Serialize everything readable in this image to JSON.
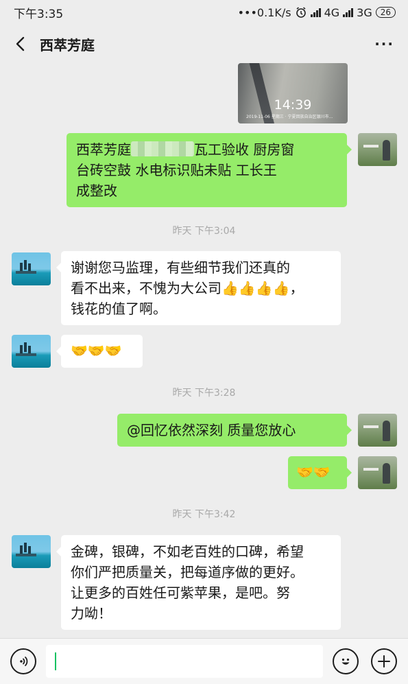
{
  "status_bar": {
    "time": "下午3:35",
    "speed": "•••0.1K/s",
    "alarm_icon": "alarm-clock-icon",
    "network_1": "4G",
    "network_2": "3G",
    "battery": "26"
  },
  "header": {
    "back_icon": "chevron-left-icon",
    "title": "西萃芳庭",
    "more_icon": "more-dots-icon",
    "more_label": "···"
  },
  "messages": {
    "photo": {
      "time": "14:39",
      "stamp": "2019-11-06 星期三 · 宁夏回族自治区银川市…"
    },
    "m1": {
      "before_blur": "西萃芳庭",
      "line1_after": "瓦工验收  厨房窗",
      "line2": "台砖空鼓  水电标识贴未贴  工长王",
      "line3": "成整改"
    },
    "t1": "昨天 下午3:04",
    "m2": {
      "line1": "谢谢您马监理，有些细节我们还真的",
      "line2_text": "看不出来，不愧为大公司",
      "line2_emoji": "👍👍👍👍",
      "line2_end": "，",
      "line3": "钱花的值了啊。"
    },
    "m3": {
      "emoji": "🤝🤝🤝"
    },
    "t2": "昨天 下午3:28",
    "m4": {
      "text": "@回忆依然深刻  质量您放心"
    },
    "m5": {
      "emoji": "🤝🤝"
    },
    "t3": "昨天 下午3:42",
    "m6": {
      "line1": "金碑，银碑，不如老百姓的口碑，希望",
      "line2": "你们严把质量关，把每道序做的更好。",
      "line3": "让更多的百姓任可紫苹果，是吧。努",
      "line4": "力呦！"
    }
  },
  "input_bar": {
    "voice_icon": "voice-icon",
    "input_value": "",
    "emoji_icon": "smiley-face-icon",
    "plus_icon": "plus-icon"
  }
}
